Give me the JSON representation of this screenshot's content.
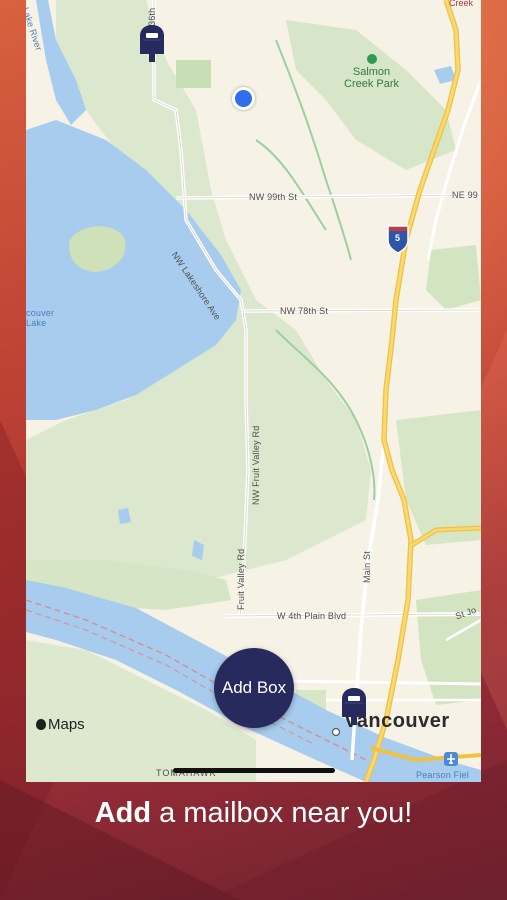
{
  "map": {
    "roads": {
      "nw99": "NW 99th St",
      "ne99": "NE 99",
      "nw78": "NW 78th St",
      "lakeshore": "NW Lakeshore Ave",
      "fruit_valley_upper": "NW Fruit Valley Rd",
      "fruit_valley_lower": "Fruit Valley Rd",
      "w4th": "W 4th Plain Blvd",
      "main": "Main St",
      "stjo": "St Jo",
      "n36": "36th",
      "lake_river": "Lake River"
    },
    "park_name_line1": "Salmon",
    "park_name_line2": "Creek Park",
    "creek_label": "Creek",
    "lake_line1": "couver",
    "lake_line2": "Lake",
    "interstate": "5",
    "city": "Vancouver",
    "pearson": "Pearson Fiel",
    "tomahawk": "TOMAHAWK",
    "attribution": "Maps",
    "icons": {
      "mailbox_color": "#272a5c",
      "user_location_color": "#2f6fea"
    }
  },
  "add_button_label": "Add Box",
  "tagline": {
    "bold": "Add",
    "rest": " a mailbox near you!"
  }
}
